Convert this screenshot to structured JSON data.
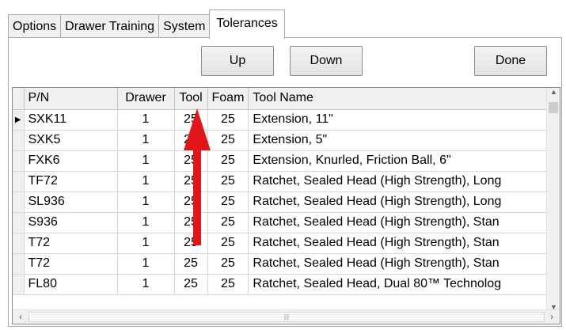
{
  "tabs": [
    {
      "label": "Options"
    },
    {
      "label": "Drawer Training"
    },
    {
      "label": "System"
    },
    {
      "label": "Tolerances"
    }
  ],
  "buttons": {
    "up": "Up",
    "down": "Down",
    "done": "Done"
  },
  "table": {
    "columns": [
      "P/N",
      "Drawer",
      "Tool",
      "Foam",
      "Tool Name"
    ],
    "rows": [
      {
        "pn": "SXK11",
        "drawer": "1",
        "tool": "25",
        "foam": "25",
        "name": "Extension, 11\""
      },
      {
        "pn": "SXK5",
        "drawer": "1",
        "tool": "25",
        "foam": "25",
        "name": "Extension, 5\""
      },
      {
        "pn": "FXK6",
        "drawer": "1",
        "tool": "25",
        "foam": "25",
        "name": "Extension, Knurled, Friction Ball, 6\""
      },
      {
        "pn": "TF72",
        "drawer": "1",
        "tool": "25",
        "foam": "25",
        "name": "Ratchet, Sealed Head (High Strength), Long"
      },
      {
        "pn": "SL936",
        "drawer": "1",
        "tool": "25",
        "foam": "25",
        "name": "Ratchet, Sealed Head (High Strength), Long"
      },
      {
        "pn": "S936",
        "drawer": "1",
        "tool": "25",
        "foam": "25",
        "name": "Ratchet, Sealed Head (High Strength), Stan"
      },
      {
        "pn": "T72",
        "drawer": "1",
        "tool": "25",
        "foam": "25",
        "name": "Ratchet, Sealed Head (High Strength), Stan"
      },
      {
        "pn": "T72",
        "drawer": "1",
        "tool": "25",
        "foam": "25",
        "name": "Ratchet, Sealed Head (High Strength), Stan"
      },
      {
        "pn": "FL80",
        "drawer": "1",
        "tool": "25",
        "foam": "25",
        "name": "Ratchet, Sealed Head, Dual 80™ Technolog"
      }
    ]
  },
  "colors": {
    "annotation_arrow": "#e0161b"
  }
}
